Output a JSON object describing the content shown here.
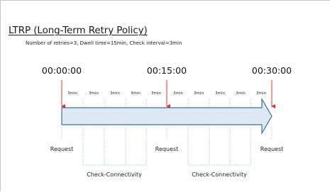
{
  "title": "LTRP (Long-Term Retry Policy)",
  "subtitle": "Number of retries=3, Dwell time=15min, Check interval=3min",
  "times": [
    "00:00:00",
    "00:15:00",
    "00:30:00"
  ],
  "request_label": "Request",
  "check_label": "Check-Connectivity",
  "interval_label": "3min",
  "colors": {
    "request_marker": "#e03030",
    "arrow_fill": "#dce9f5",
    "arrow_stroke": "#3f6f8f",
    "interval_line": "#8cb4d4"
  },
  "icons": [
    "request-marker-arrow",
    "timeline-arrow"
  ]
}
